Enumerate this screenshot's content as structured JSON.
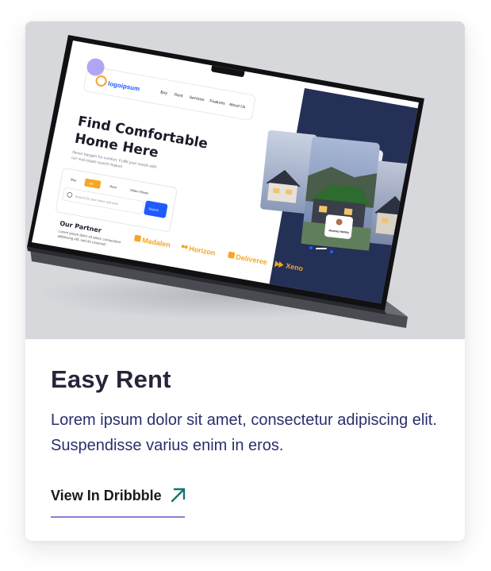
{
  "card": {
    "title": "Easy Rent",
    "description": "Lorem ipsum dolor sit amet, consectetur adipiscing elit. Suspendisse varius enim in eros.",
    "link_label": "View In Dribbble",
    "link_icon": "arrow-up-right-icon"
  },
  "mockup": {
    "logo_text": "logoipsum",
    "nav": [
      "Buy",
      "Rent",
      "Services",
      "Features",
      "About Us"
    ],
    "headline_line1": "Find Comfortable",
    "headline_line2": "Home Here",
    "subtext_line1": "Never bargain for comfort. Fulfill your needs with",
    "subtext_line2": "our real estate search feature",
    "tabs": [
      "Buy",
      "All",
      "Rent",
      "Share House"
    ],
    "search_placeholder": "Search for your home and land",
    "search_button": "Search",
    "partner_heading": "Our Partner",
    "partner_text_line1": "Lorem ipsum dolor sit amet, consectetur",
    "partner_text_line2": "adipiscing elit, sed do eiusmod.",
    "partners": [
      "Madalen",
      "Horizon",
      "Deliveree",
      "Xeno"
    ],
    "profile_name": "Rosney Hemky",
    "colors": {
      "accent": "#f5a623",
      "primary": "#1f5bff",
      "dark_panel": "#243055",
      "link_underline": "#8b7fd6",
      "arrow": "#0f766e"
    }
  }
}
